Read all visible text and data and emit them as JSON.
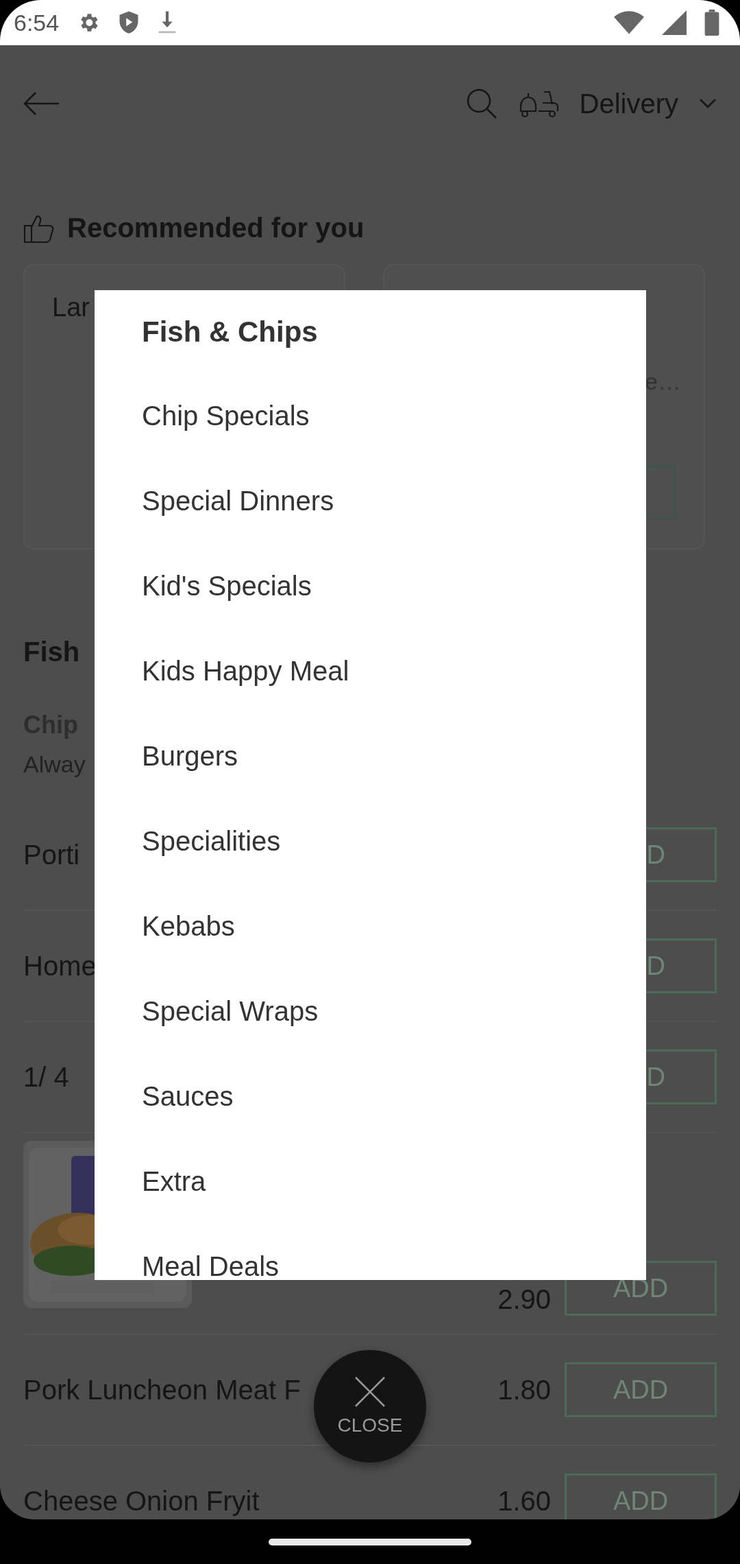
{
  "status_bar": {
    "time": "6:54"
  },
  "app_bar": {
    "delivery_label": "Delivery"
  },
  "recommended": {
    "title": "Recommended for you",
    "cards": [
      {
        "text": "Lar"
      },
      {
        "text": "e…"
      }
    ]
  },
  "menu_section": {
    "title": "Fish",
    "subsection_title": "Chip",
    "subsection_note": "Alway"
  },
  "items": [
    {
      "kind": "text",
      "name": "Porti",
      "button": "D"
    },
    {
      "kind": "text",
      "name": "Home",
      "button": "D"
    },
    {
      "kind": "text",
      "name": "1/ 4",
      "button": "D"
    },
    {
      "price": "2.90",
      "button": "ADD"
    },
    {
      "kind": "text",
      "name": "Pork Luncheon Meat F",
      "price": "1.80",
      "button": "ADD"
    },
    {
      "kind": "text",
      "name": "Cheese Onion Fryit",
      "price": "1.60",
      "button": "ADD"
    }
  ],
  "category_dialog": {
    "title": "Fish & Chips",
    "categories": [
      "Chip Specials",
      "Special Dinners",
      "Kid's Specials",
      "Kids Happy Meal",
      "Burgers",
      "Specialities",
      "Kebabs",
      "Special Wraps",
      "Sauces",
      "Extra",
      "Meal Deals"
    ]
  },
  "close_button": {
    "label": "CLOSE"
  }
}
